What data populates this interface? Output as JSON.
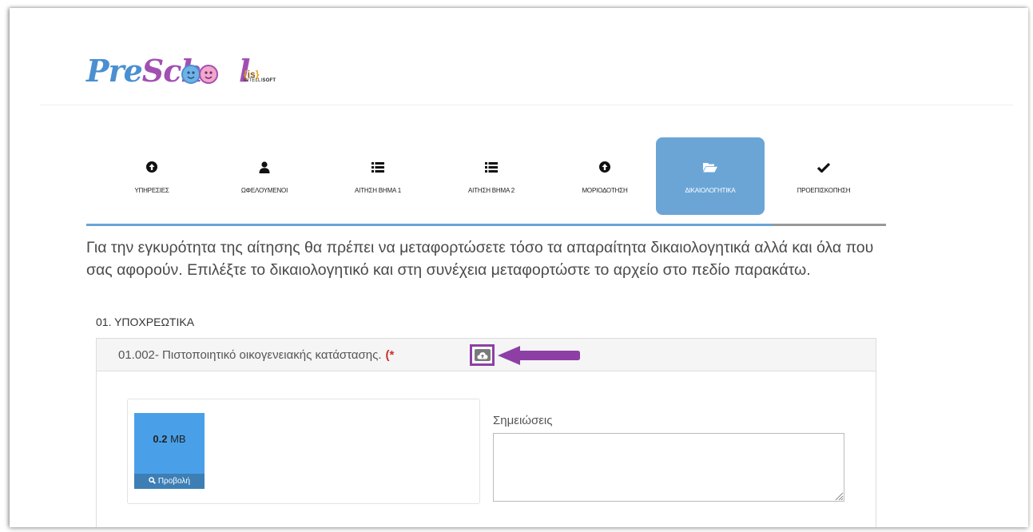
{
  "logo": {
    "pre": "Pre",
    "school": "Sch",
    "school_end": "l"
  },
  "brand": {
    "top_left": "{",
    "top_mid": "is",
    "top_right": "}",
    "bottom_a": "INTELLI",
    "bottom_b": "SOFT"
  },
  "wizard": {
    "steps": [
      {
        "label": "ΥΠΗΡΕΣΙΕΣ",
        "icon": "circle-up-arrow-icon",
        "active": false
      },
      {
        "label": "ΩΦΕΛΟΥΜΕΝΟΙ",
        "icon": "user-icon",
        "active": false
      },
      {
        "label": "ΑΙΤΗΣΗ ΒΗΜΑ 1",
        "icon": "list-icon",
        "active": false
      },
      {
        "label": "ΑΙΤΗΣΗ ΒΗΜΑ 2",
        "icon": "list-icon",
        "active": false
      },
      {
        "label": "ΜΟΡΙΟΔΟΤΗΣΗ",
        "icon": "circle-up-arrow-icon",
        "active": false
      },
      {
        "label": "ΔΙΚΑΙΟΛΟΓΗΤΙΚΑ",
        "icon": "folder-open-icon",
        "active": true
      },
      {
        "label": "ΠΡΟΕΠΙΣΚΟΠΗΣΗ",
        "icon": "check-icon",
        "active": false
      }
    ],
    "progress_fraction": 0.857
  },
  "intro_text": "Για την εγκυρότητα της αίτησης θα πρέπει να μεταφορτώσετε τόσο τα απαραίτητα δικαιολογητικά αλλά και όλα που σας αφορούν. Επιλέξτε το δικαιολογητικό και στη συνέχεια μεταφορτώστε το αρχείο στο πεδίο παρακάτω.",
  "section_title": "01. ΥΠΟΧΡΕΩΤΙΚΑ",
  "document": {
    "title": "01.002- Πιστοποιητικό οικογενειακής κατάστασης.",
    "required_marker": "(*",
    "upload_icon": "cloud-upload-icon",
    "highlight_color": "#8d3fa6"
  },
  "file": {
    "size_value": "0.2",
    "size_unit": "MB",
    "preview_label": "Προβολή"
  },
  "notes": {
    "label": "Σημειώσεις",
    "value": ""
  },
  "colors": {
    "accent": "#6aa5d6",
    "file_tile": "#4aa0e8",
    "required": "#c9302c"
  }
}
